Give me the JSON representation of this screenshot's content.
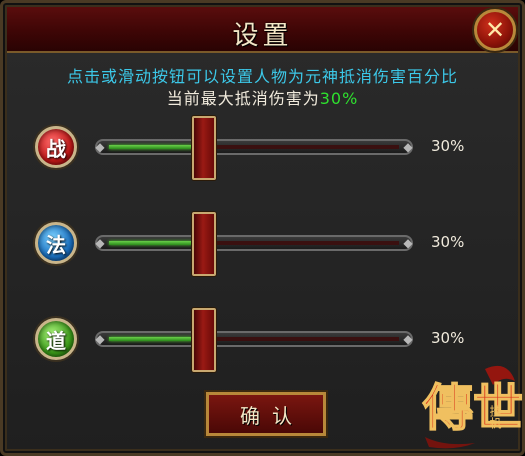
{
  "dialog": {
    "title": "设置",
    "close_icon": "close-x-icon"
  },
  "info": {
    "line1": "点击或滑动按钮可以设置人物为元神抵消伤害百分比",
    "line2_prefix": "当前最大抵消伤害为",
    "line2_value": "30%"
  },
  "sliders": [
    {
      "badge": "战",
      "badge_color": "#c01818",
      "value": 0.3,
      "label": "30%"
    },
    {
      "badge": "法",
      "badge_color": "#1a70c0",
      "value": 0.3,
      "label": "30%"
    },
    {
      "badge": "道",
      "badge_color": "#3a9a18",
      "value": 0.3,
      "label": "30%"
    }
  ],
  "confirm_label": "确认",
  "logo_text": "傳世",
  "logo_sub": "挂机",
  "colors": {
    "accent_cyan": "#3cc8e8",
    "accent_green": "#2ee02e",
    "title_red": "#5a0d0d",
    "gold_border": "#b8883a"
  }
}
